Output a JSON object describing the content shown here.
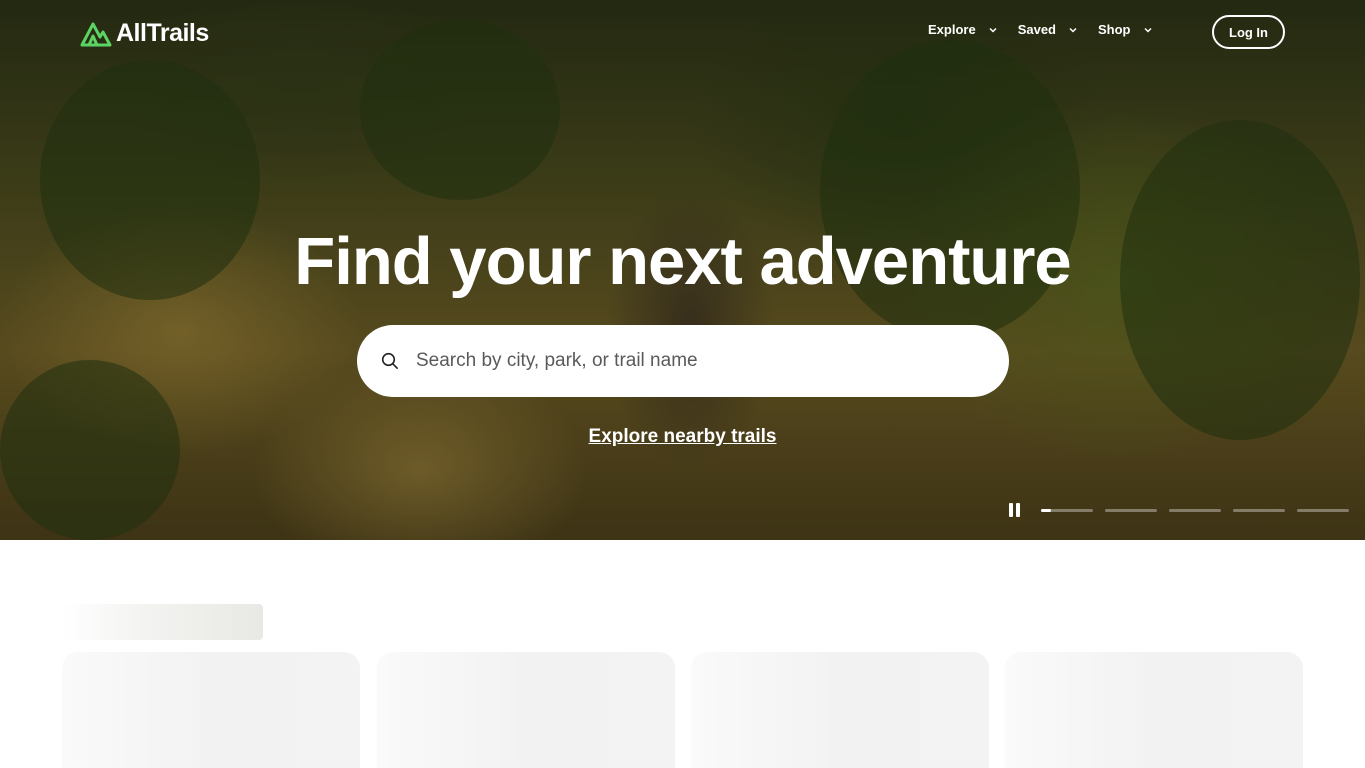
{
  "header": {
    "logo_text": "AllTrails",
    "nav": [
      {
        "label": "Explore"
      },
      {
        "label": "Saved"
      },
      {
        "label": "Shop"
      }
    ],
    "login_label": "Log In"
  },
  "hero": {
    "headline": "Find your next adventure",
    "search": {
      "placeholder": "Search by city, park, or trail name",
      "value": ""
    },
    "explore_link": "Explore nearby trails",
    "carousel": {
      "slides": 5,
      "active_index": 0,
      "active_progress": 0.2
    }
  },
  "colors": {
    "brand_green": "#5bd463",
    "text_white": "#ffffff"
  },
  "icons": {
    "logo": "alltrails-mountain-icon",
    "search": "search-icon",
    "chevron": "chevron-down-icon",
    "pause": "pause-icon"
  }
}
